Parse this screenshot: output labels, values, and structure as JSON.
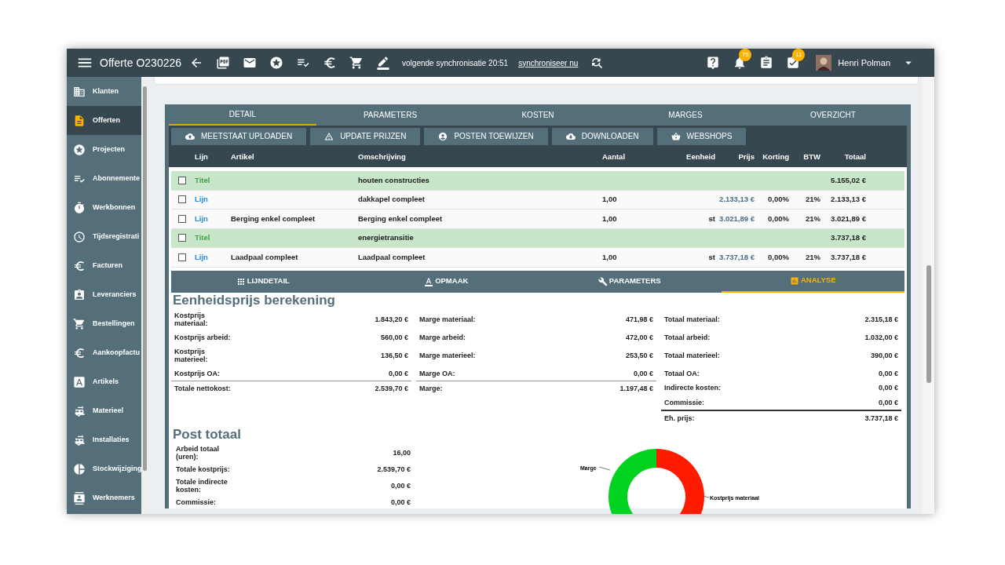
{
  "header": {
    "title": "Offerte O230226",
    "sync_text": "volgende synchronisatie 20:51",
    "sync_link": "synchroniseer nu",
    "notification_badge": "75",
    "task_badge": "11",
    "user_name": "Henri Polman"
  },
  "sidebar": {
    "items": [
      {
        "label": "Klanten",
        "selected": false
      },
      {
        "label": "Offerten",
        "selected": true
      },
      {
        "label": "Projecten",
        "selected": false
      },
      {
        "label": "Abonnemente",
        "selected": false
      },
      {
        "label": "Werkbonnen",
        "selected": false
      },
      {
        "label": "Tijdsregistrati",
        "selected": false
      },
      {
        "label": "Facturen",
        "selected": false
      },
      {
        "label": "Leveranciers",
        "selected": false
      },
      {
        "label": "Bestellingen",
        "selected": false
      },
      {
        "label": "Aankoopfactu",
        "selected": false
      },
      {
        "label": "Artikels",
        "selected": false
      },
      {
        "label": "Materieel",
        "selected": false
      },
      {
        "label": "Installaties",
        "selected": false
      },
      {
        "label": "Stockwijziging",
        "selected": false
      },
      {
        "label": "Werknemers",
        "selected": false
      }
    ]
  },
  "tabs": [
    {
      "label": "DETAIL",
      "selected": true
    },
    {
      "label": "PARAMETERS",
      "selected": false
    },
    {
      "label": "KOSTEN",
      "selected": false
    },
    {
      "label": "MARGES",
      "selected": false
    },
    {
      "label": "OVERZICHT",
      "selected": false
    }
  ],
  "actions": [
    "MEETSTAAT UPLOADEN",
    "UPDATE PRIJZEN",
    "POSTEN TOEWIJZEN",
    "DOWNLOADEN",
    "WEBSHOPS"
  ],
  "table": {
    "columns": [
      "Lijn",
      "Artikel",
      "Omschrijving",
      "Aantal",
      "Eenheid",
      "Prijs",
      "Korting",
      "BTW",
      "Totaal"
    ],
    "rows": [
      {
        "kind": "title",
        "checked": false,
        "lijn": "Titel",
        "omschrijving": "houten constructies",
        "totaal": "5.155,02 €"
      },
      {
        "kind": "line",
        "checked": false,
        "lijn": "Lijn",
        "omschrijving": "dakkapel compleet",
        "aantal": "1,00",
        "prijs": "2.133,13 €",
        "korting": "0,00%",
        "btw": "21%",
        "totaal": "2.133,13 €"
      },
      {
        "kind": "line",
        "checked": false,
        "lijn": "Lijn",
        "artikel": "Berging enkel compleet",
        "omschrijving": "Berging enkel compleet",
        "aantal": "1,00",
        "eenheid": "st",
        "prijs": "3.021,89 €",
        "korting": "0,00%",
        "btw": "21%",
        "totaal": "3.021,89 €"
      },
      {
        "kind": "title",
        "checked": false,
        "lijn": "Titel",
        "omschrijving": "energietransitie",
        "totaal": "3.737,18 €"
      },
      {
        "kind": "line",
        "checked": false,
        "lijn": "Lijn",
        "artikel": "Laadpaal compleet",
        "omschrijving": "Laadpaal compleet",
        "aantal": "1,00",
        "eenheid": "st",
        "prijs": "3.737,18 €",
        "korting": "0,00%",
        "btw": "21%",
        "totaal": "3.737,18 €"
      }
    ]
  },
  "detail_tabs": [
    {
      "label": "LIJNDETAIL",
      "selected": false
    },
    {
      "label": "OPMAAK",
      "selected": false
    },
    {
      "label": "PARAMETERS",
      "selected": false
    },
    {
      "label": "ANALYSE",
      "selected": true
    }
  ],
  "unit_price": {
    "title": "Eenheidsprijs berekening",
    "columns": [
      {
        "rows": [
          {
            "kind": "plain",
            "label": "Kostprijs materiaal:",
            "value": "1.843,20 €"
          },
          {
            "kind": "plain",
            "label": "Kostprijs arbeid:",
            "value": "560,00 €"
          },
          {
            "kind": "plain",
            "label": "Kostprijs materieel:",
            "value": "136,50 €"
          },
          {
            "kind": "plain",
            "label": "Kostprijs OA:",
            "value": "0,00 €"
          },
          {
            "kind": "total",
            "label": "Totale nettokost:",
            "value": "2.539,70 €"
          }
        ]
      },
      {
        "rows": [
          {
            "kind": "plain",
            "label": "Marge materiaal:",
            "value": "471,98 €"
          },
          {
            "kind": "plain",
            "label": "Marge arbeid:",
            "value": "472,00 €"
          },
          {
            "kind": "plain",
            "label": "Marge materieel:",
            "value": "253,50 €"
          },
          {
            "kind": "plain",
            "label": "Marge OA:",
            "value": "0,00 €"
          },
          {
            "kind": "total",
            "label": "Marge:",
            "value": "1.197,48 €"
          }
        ]
      },
      {
        "rows": [
          {
            "kind": "plain",
            "label": "Totaal materiaal:",
            "value": "2.315,18 €"
          },
          {
            "kind": "plain",
            "label": "Totaal arbeid:",
            "value": "1.032,00 €"
          },
          {
            "kind": "plain",
            "label": "Totaal materieel:",
            "value": "390,00 €"
          },
          {
            "kind": "plain",
            "label": "Totaal OA:",
            "value": "0,00 €"
          },
          {
            "kind": "plain",
            "label": "Indirecte kosten:",
            "value": "0,00 €"
          },
          {
            "kind": "plain",
            "label": "Commissie:",
            "value": "0,00 €"
          },
          {
            "kind": "grand",
            "label": "Eh. prijs:",
            "value": "3.737,18 €"
          }
        ]
      }
    ]
  },
  "post_total": {
    "title": "Post totaal",
    "rows": [
      {
        "label": "Arbeid totaal (uren):",
        "value": "16,00"
      },
      {
        "label": "Totale kostprijs:",
        "value": "2.539,70 €"
      },
      {
        "label": "Totale indirecte kosten:",
        "value": "0,00 €"
      },
      {
        "label": "Commissie:",
        "value": "0,00 €"
      }
    ],
    "donut_labels": [
      "Marge",
      "Kostprijs materiaal"
    ]
  }
}
